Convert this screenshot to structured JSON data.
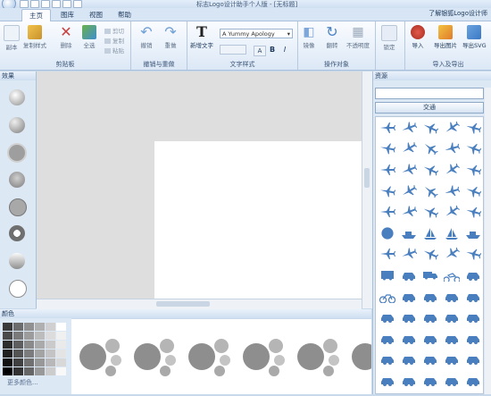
{
  "window": {
    "title": "标志Logo设计助手个人版 - [无标题]"
  },
  "tabs": [
    {
      "label": "主页",
      "active": true
    },
    {
      "label": "图库",
      "active": false
    },
    {
      "label": "视图",
      "active": false
    },
    {
      "label": "帮助",
      "active": false
    }
  ],
  "help_link": "了解银狐Logo设计师",
  "ribbon": {
    "groups": {
      "clipboard": "剪贴板",
      "undo_redo": "撤销与重做",
      "text_style": "文字样式",
      "operate": "操作对象",
      "import_export": "导入及导出"
    },
    "buttons": {
      "copy_style_source": "副本",
      "copy_style": "复制样式",
      "delete": "删除",
      "select_all": "全选",
      "cut": "剪切",
      "copy": "复制",
      "paste": "粘贴",
      "undo": "撤销",
      "redo": "重做",
      "new_text": "新增文字",
      "mirror": "镜像",
      "rotate": "翻转",
      "opacity": "不透明度",
      "lock": "锁定",
      "import": "导入",
      "export_image": "导出图片",
      "export_svg": "导出SVG"
    },
    "font_value": "A Yummy Apology",
    "font_size_value": "",
    "bold": "B",
    "italic": "I"
  },
  "effects_panel": {
    "title": "效果"
  },
  "colors_panel": {
    "title": "颜色",
    "more_colors": "更多颜色..."
  },
  "resources_panel": {
    "title": "资源",
    "search_placeholder": "",
    "category": "交通"
  },
  "colors": {
    "accent": "#3b78c4",
    "ribbon_bg": "#dce8f6",
    "icon_fill": "#4a7fbf",
    "effect_gray": "#a8a8a8",
    "canvas_bg": "#dedede",
    "import_red": "#c0392b"
  },
  "swatches": [
    "#3a3a3a",
    "#6c6c6c",
    "#909090",
    "#b0b0b0",
    "#d0d0d0",
    "#ffffff",
    "#4a4a4a",
    "#7a7a7a",
    "#9c9c9c",
    "#bcbcbc",
    "#dcdcdc",
    "#f0f0f0",
    "#2e2e2e",
    "#5e5e5e",
    "#8a8a8a",
    "#aaaaaa",
    "#cacaca",
    "#eaeaea",
    "#202020",
    "#545454",
    "#7c7c7c",
    "#a4a4a4",
    "#c4c4c4",
    "#e4e4e4",
    "#111111",
    "#404040",
    "#707070",
    "#989898",
    "#b8b8b8",
    "#d8d8d8",
    "#000000",
    "#333333",
    "#666666",
    "#999999",
    "#cccccc",
    "#f8f8f8"
  ],
  "resource_icons": [
    "plane-icon",
    "plane-icon",
    "plane-icon",
    "plane-icon",
    "plane-icon",
    "plane-icon",
    "plane-icon",
    "plane-icon",
    "plane-icon",
    "plane-icon",
    "plane-icon",
    "plane-icon",
    "plane-icon",
    "plane-icon",
    "plane-icon",
    "plane-icon",
    "plane-icon",
    "plane-icon",
    "plane-icon",
    "plane-icon",
    "plane-icon",
    "plane-icon",
    "plane-icon",
    "plane-icon",
    "plane-icon",
    "globe-icon",
    "ship-icon",
    "sailboat-icon",
    "sailboat-icon",
    "ship-icon",
    "plane-icon",
    "plane-icon",
    "plane-icon",
    "plane-icon",
    "plane-icon",
    "bus-icon",
    "car-icon",
    "truck-icon",
    "motorcycle-icon",
    "car-icon",
    "bicycle-icon",
    "car-icon",
    "car-icon",
    "car-icon",
    "car-icon",
    "car-icon",
    "car-icon",
    "car-icon",
    "car-icon",
    "car-icon",
    "car-icon",
    "car-icon",
    "car-icon",
    "car-icon",
    "car-icon",
    "car-icon",
    "car-icon",
    "car-icon",
    "car-icon",
    "car-icon",
    "car-icon",
    "car-icon",
    "car-icon",
    "car-icon",
    "car-icon"
  ]
}
